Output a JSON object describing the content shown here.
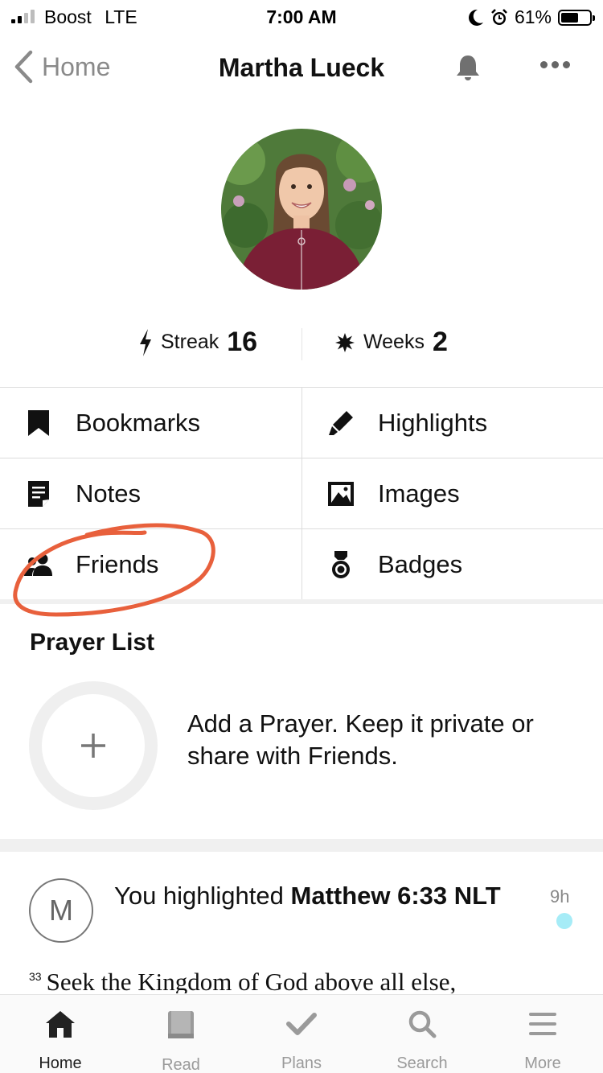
{
  "status_bar": {
    "carrier": "Boost",
    "network": "LTE",
    "time": "7:00 AM",
    "battery_percent": "61%",
    "battery_level": 0.61
  },
  "nav": {
    "back_label": "Home",
    "title": "Martha Lueck"
  },
  "stats": {
    "streak_label": "Streak",
    "streak_value": "16",
    "weeks_label": "Weeks",
    "weeks_value": "2"
  },
  "grid": {
    "bookmarks": "Bookmarks",
    "highlights": "Highlights",
    "notes": "Notes",
    "images": "Images",
    "friends": "Friends",
    "badges": "Badges"
  },
  "prayer": {
    "title": "Prayer List",
    "description": "Add a Prayer. Keep it private or share with Friends."
  },
  "activity": {
    "avatar_letter": "M",
    "prefix": "You highlighted ",
    "reference": "Matthew 6:33 NLT",
    "time": "9h",
    "verse_number": "33",
    "verse_text": "Seek the Kingdom of God above all else,"
  },
  "tabs": [
    {
      "label": "Home"
    },
    {
      "label": "Read"
    },
    {
      "label": "Plans"
    },
    {
      "label": "Search"
    },
    {
      "label": "More"
    }
  ],
  "colors": {
    "annotation": "#e8603c",
    "unread_dot": "#a6ecf7"
  }
}
